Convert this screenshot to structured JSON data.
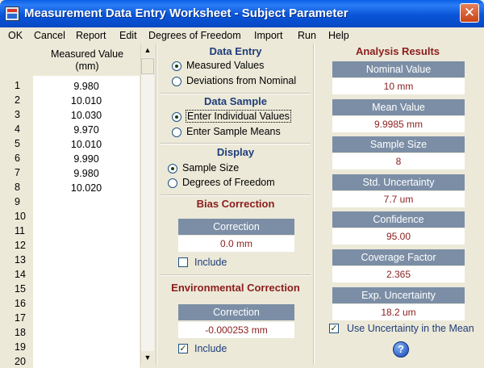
{
  "window": {
    "title": "Measurement Data Entry Worksheet - Subject Parameter",
    "close_glyph": "✕"
  },
  "menu": [
    "OK",
    "Cancel",
    "Report",
    "Edit",
    "Degrees of Freedom",
    "Import",
    "Run",
    "Help"
  ],
  "data_table": {
    "header_line1": "Measured Value",
    "header_line2": "(mm)",
    "rows": [
      {
        "n": "1",
        "v": "9.980"
      },
      {
        "n": "2",
        "v": "10.010"
      },
      {
        "n": "3",
        "v": "10.030"
      },
      {
        "n": "4",
        "v": "9.970"
      },
      {
        "n": "5",
        "v": "10.010"
      },
      {
        "n": "6",
        "v": "9.990"
      },
      {
        "n": "7",
        "v": "9.980"
      },
      {
        "n": "8",
        "v": "10.020"
      },
      {
        "n": "9",
        "v": ""
      },
      {
        "n": "10",
        "v": ""
      },
      {
        "n": "11",
        "v": ""
      },
      {
        "n": "12",
        "v": ""
      },
      {
        "n": "13",
        "v": ""
      },
      {
        "n": "14",
        "v": ""
      },
      {
        "n": "15",
        "v": ""
      },
      {
        "n": "16",
        "v": ""
      },
      {
        "n": "17",
        "v": ""
      },
      {
        "n": "18",
        "v": ""
      },
      {
        "n": "19",
        "v": ""
      },
      {
        "n": "20",
        "v": ""
      }
    ],
    "scroll_up": "▲",
    "scroll_down": "▼"
  },
  "data_entry": {
    "title": "Data Entry",
    "opt1": "Measured Values",
    "opt2": "Deviations from Nominal",
    "selected": 1
  },
  "data_sample": {
    "title": "Data Sample",
    "opt1": "Enter Individual Values",
    "opt2": "Enter Sample Means",
    "selected": 1
  },
  "display": {
    "title": "Display",
    "opt1": "Sample Size",
    "opt2": "Degrees of Freedom",
    "selected": 1
  },
  "bias_correction": {
    "title": "Bias Correction",
    "head": "Correction",
    "value": "0.0 mm",
    "include_label": "Include",
    "include_checked": false
  },
  "env_correction": {
    "title": "Environmental Correction",
    "head": "Correction",
    "value": "-0.000253 mm",
    "include_label": "Include",
    "include_checked": true
  },
  "analysis": {
    "title": "Analysis Results",
    "items": [
      {
        "label": "Nominal Value",
        "value": "10 mm"
      },
      {
        "label": "Mean Value",
        "value": "9.9985 mm"
      },
      {
        "label": "Sample Size",
        "value": "8"
      },
      {
        "label": "Std. Uncertainty",
        "value": "7.7 um"
      },
      {
        "label": "Confidence",
        "value": "95.00"
      },
      {
        "label": "Coverage Factor",
        "value": "2.365"
      },
      {
        "label": "Exp. Uncertainty",
        "value": "18.2 um"
      }
    ],
    "use_uncertainty_label": "Use Uncertainty in the Mean",
    "use_uncertainty_checked": true,
    "help_glyph": "?"
  }
}
